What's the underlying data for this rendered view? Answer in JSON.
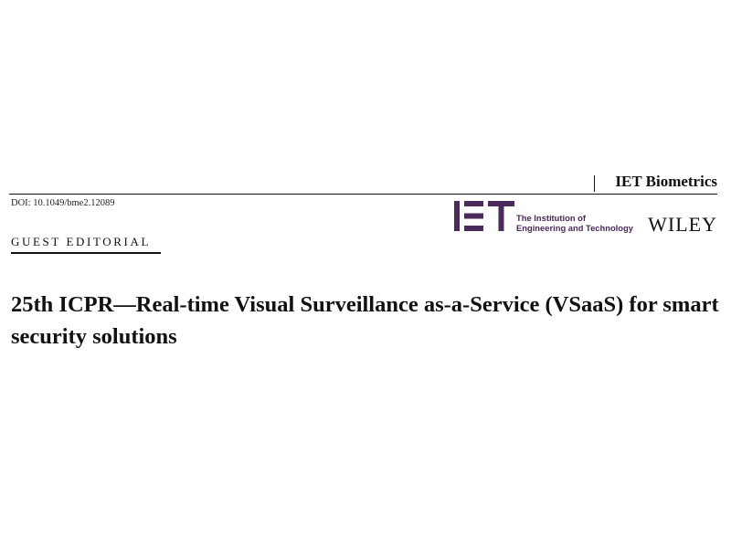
{
  "header": {
    "journal": "IET Biometrics",
    "doi": "DOI: 10.1049/bme2.12089"
  },
  "section": {
    "label": "GUEST EDITORIAL"
  },
  "logos": {
    "iet_line1": "The Institution of",
    "iet_line2": "Engineering and Technology",
    "publisher": "WILEY",
    "iet_color": "#4a2a5a"
  },
  "article": {
    "title": "25th ICPR—Real-time Visual Surveillance as-a-Service (VSaaS) for smart security solutions"
  }
}
